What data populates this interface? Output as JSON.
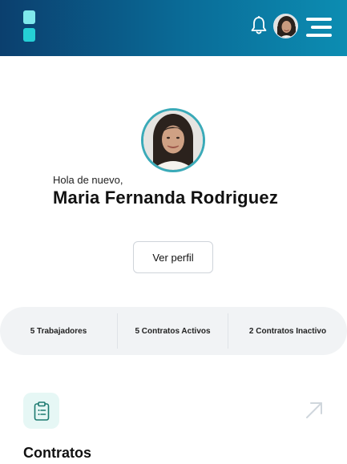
{
  "header": {
    "logo_icon": "app-logo-icon",
    "bell_icon": "bell-icon",
    "avatar": "user-avatar",
    "menu_icon": "hamburger-menu-icon",
    "accent": "#0a6d99"
  },
  "profile": {
    "greeting": "Hola de nuevo,",
    "name": "Maria Fernanda Rodriguez",
    "button_label": "Ver perfil"
  },
  "stats": [
    {
      "label": "5 Trabajadores"
    },
    {
      "label": "5 Contratos Activos"
    },
    {
      "label": "2 Contratos Inactivo"
    }
  ],
  "section": {
    "icon": "clipboard-list-icon",
    "arrow_icon": "arrow-up-right-icon",
    "title": "Contratos",
    "icon_color": "#1c7a70"
  }
}
